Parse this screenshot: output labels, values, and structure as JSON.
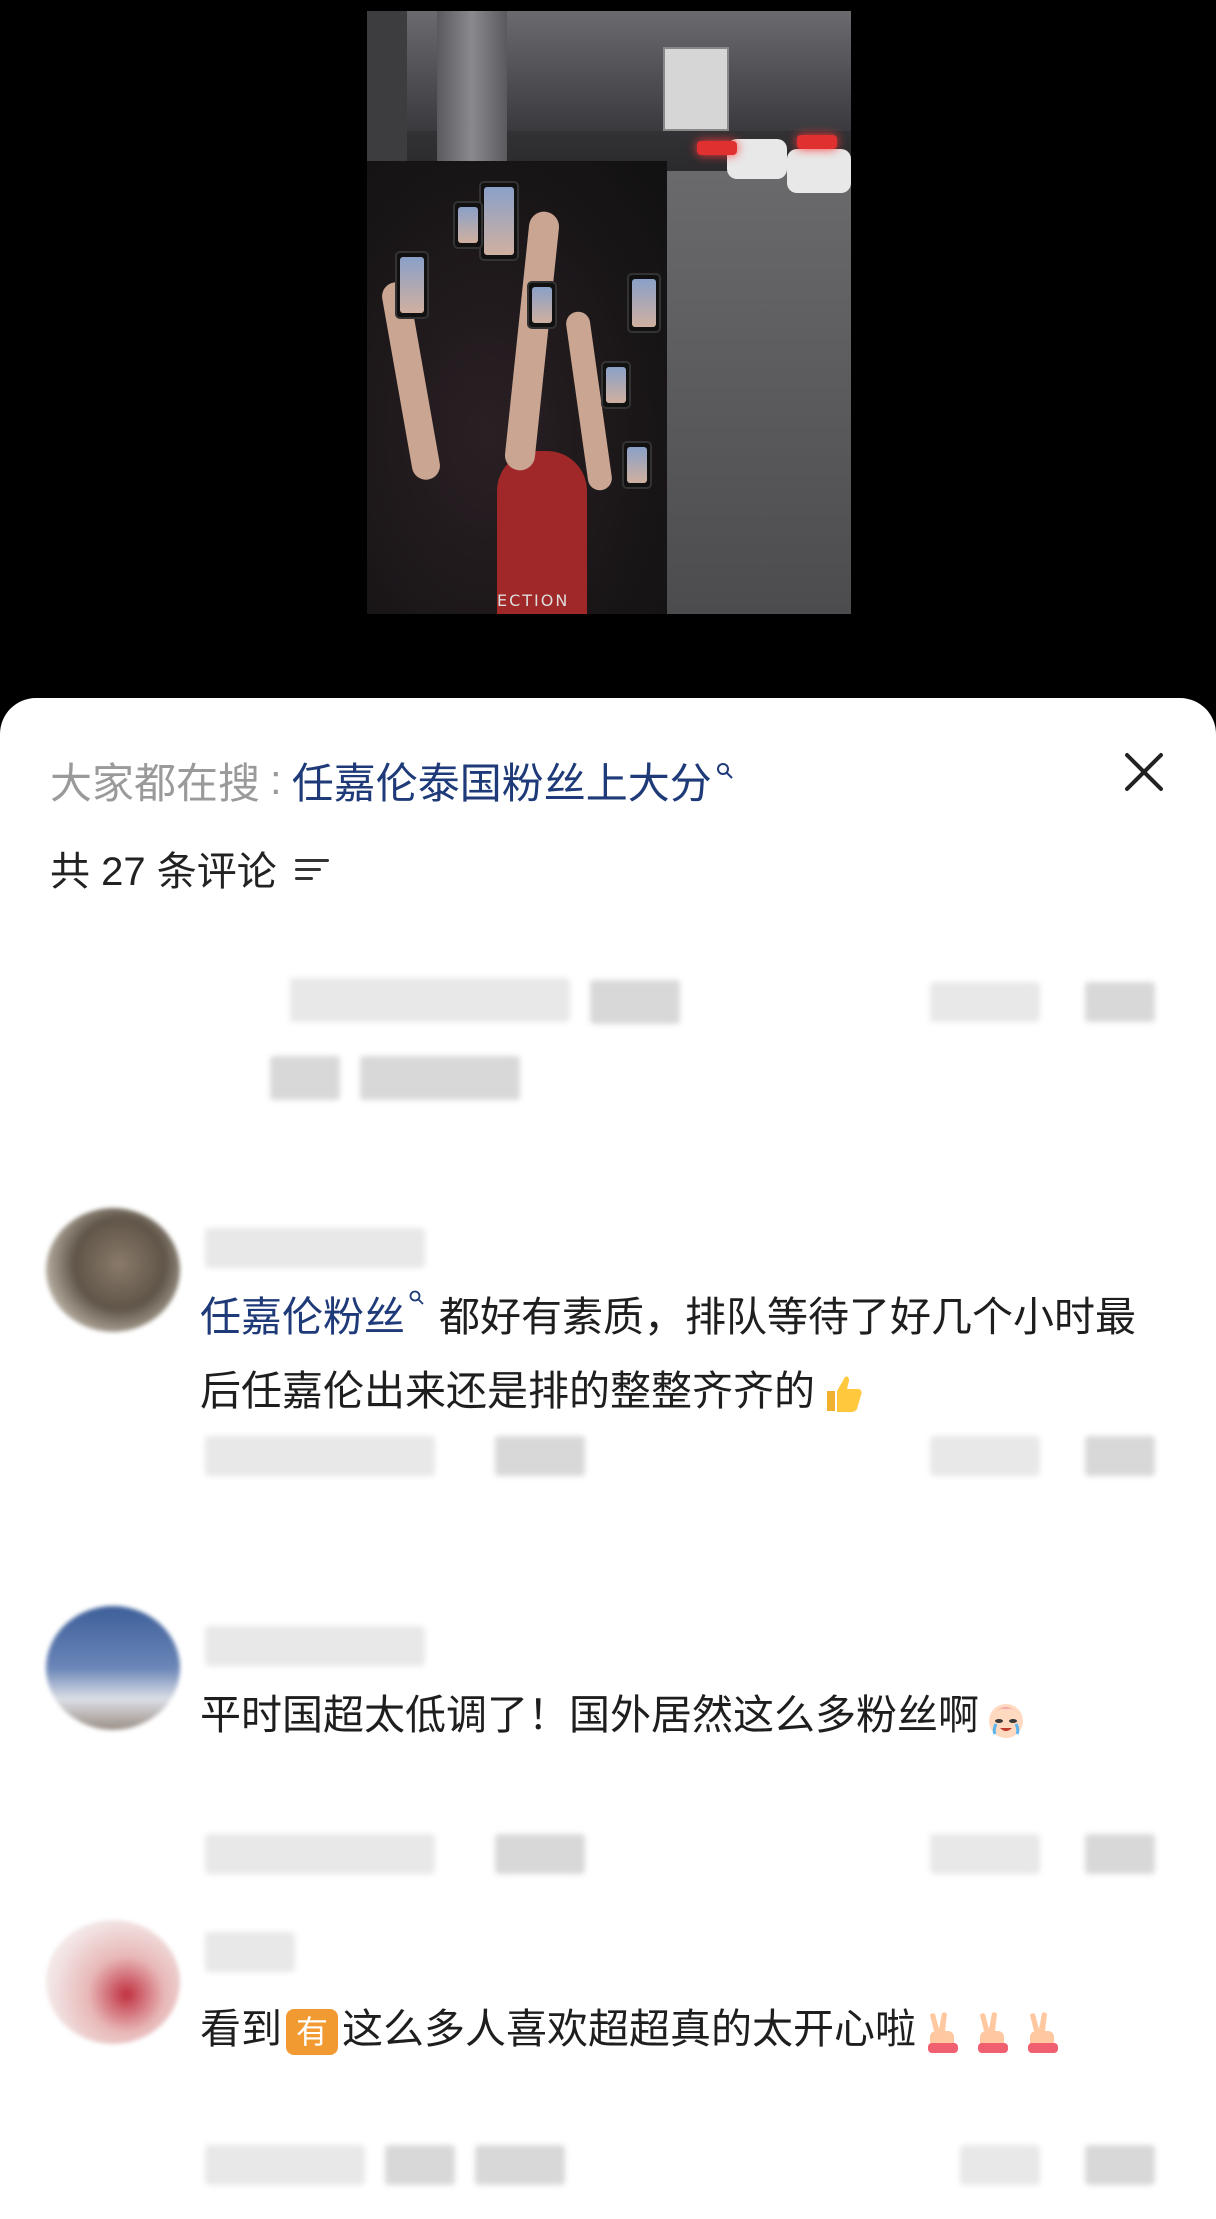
{
  "search": {
    "prefix": "大家都在搜",
    "separator": ":",
    "keyword": "任嘉伦泰国粉丝上大分",
    "keyword_icon": "search-icon"
  },
  "comments_header": {
    "count_label": "共 27 条评论",
    "sort_icon": "sort-icon"
  },
  "close_icon": "close-icon",
  "video": {
    "overlay_text": "ECTION"
  },
  "comments": [
    {
      "topic": "任嘉伦粉丝",
      "text": "都好有素质，排队等待了好几个小时最后任嘉伦出来还是排的整整齐齐的",
      "emoji": "thumbs-up-icon"
    },
    {
      "text": "平时国超太低调了！国外居然这么多粉丝啊",
      "emoji": "crying-laughing-baby-icon"
    },
    {
      "prefix": "看到",
      "badge": "有",
      "text": "这么多人喜欢超超真的太开心啦",
      "emoji": "victory-hand-icon"
    }
  ]
}
